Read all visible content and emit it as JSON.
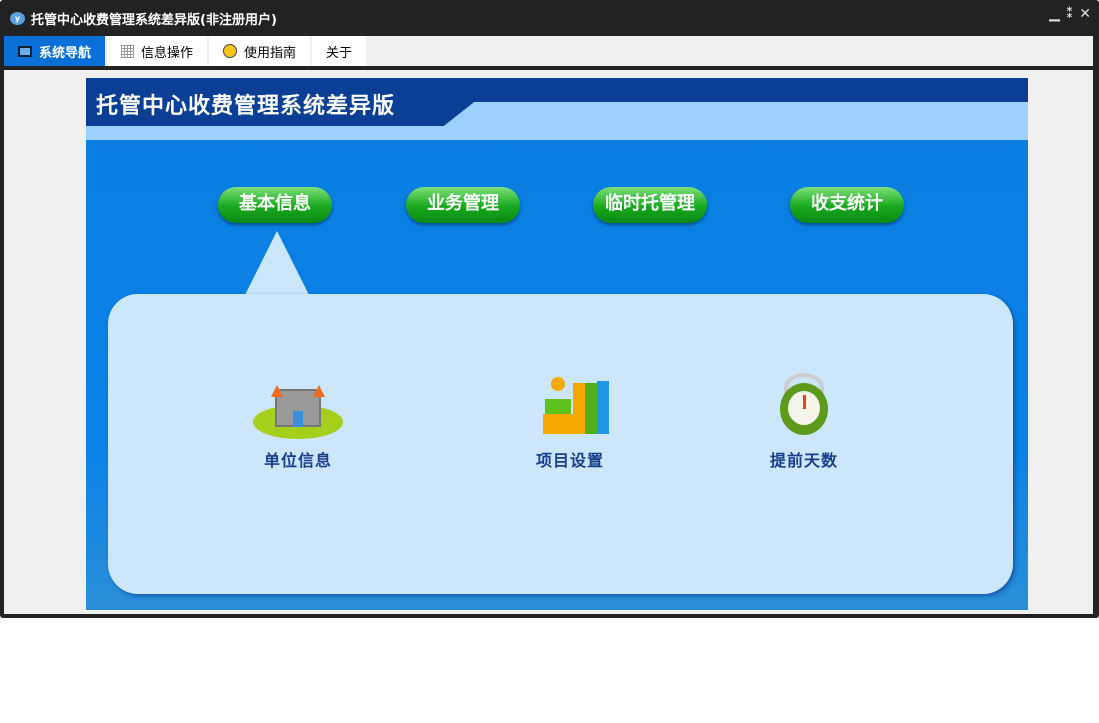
{
  "window": {
    "title": "托管中心收费管理系统差异版(非注册用户)"
  },
  "tabs": [
    {
      "label": "系统导航",
      "active": true
    },
    {
      "label": "信息操作"
    },
    {
      "label": "使用指南"
    },
    {
      "label": "关于"
    }
  ],
  "banner": {
    "title": "托管中心收费管理系统差异版"
  },
  "nav_buttons": [
    "基本信息",
    "业务管理",
    "临时托管理",
    "收支统计"
  ],
  "items": [
    {
      "label": "单位信息",
      "icon": "castle-icon"
    },
    {
      "label": "项目设置",
      "icon": "books-icon"
    },
    {
      "label": "提前天数",
      "icon": "alarm-clock-icon"
    }
  ]
}
